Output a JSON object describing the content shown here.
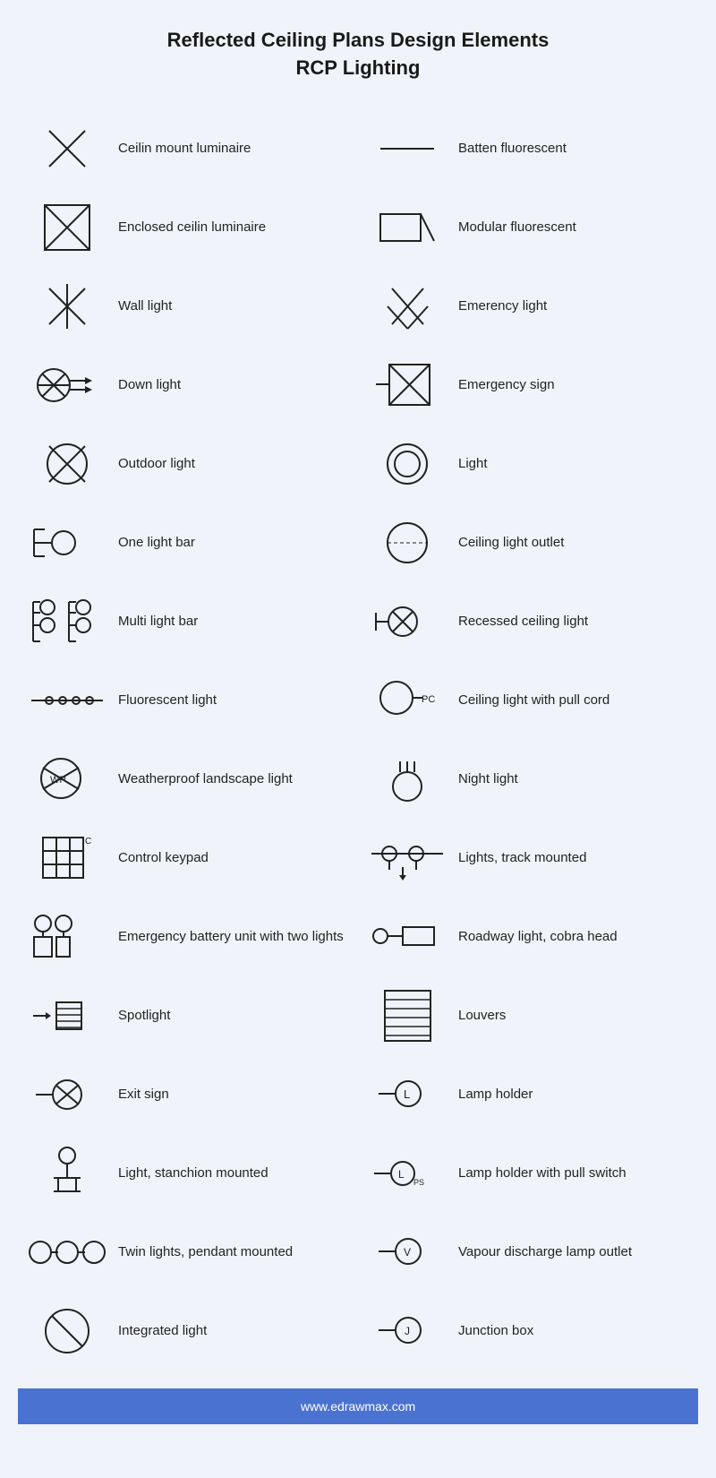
{
  "header": {
    "line1": "Reflected Ceiling Plans Design Elements",
    "line2": "RCP Lighting"
  },
  "items_left": [
    {
      "label": "Ceilin mount luminaire",
      "icon": "ceiling-mount"
    },
    {
      "label": "Enclosed ceilin luminaire",
      "icon": "enclosed-ceiling"
    },
    {
      "label": "Wall light",
      "icon": "wall-light"
    },
    {
      "label": "Down light",
      "icon": "down-light"
    },
    {
      "label": "Outdoor light",
      "icon": "outdoor-light"
    },
    {
      "label": "One light bar",
      "icon": "one-light-bar"
    },
    {
      "label": "Multi light bar",
      "icon": "multi-light-bar"
    },
    {
      "label": "Fluorescent light",
      "icon": "fluorescent-light"
    },
    {
      "label": "Weatherproof landscape light",
      "icon": "weatherproof"
    },
    {
      "label": "Control keypad",
      "icon": "control-keypad"
    },
    {
      "label": "Emergency battery unit with two lights",
      "icon": "emergency-battery"
    },
    {
      "label": "Spotlight",
      "icon": "spotlight"
    },
    {
      "label": "Exit sign",
      "icon": "exit-sign"
    },
    {
      "label": "Light, stanchion mounted",
      "icon": "stanchion"
    },
    {
      "label": "Twin lights, pendant mounted",
      "icon": "twin-pendant"
    },
    {
      "label": "Integrated light",
      "icon": "integrated-light"
    }
  ],
  "items_right": [
    {
      "label": "Batten fluorescent",
      "icon": "batten"
    },
    {
      "label": "Modular fluorescent",
      "icon": "modular-fluorescent"
    },
    {
      "label": "Emerency light",
      "icon": "emergency-light"
    },
    {
      "label": "Emergency sign",
      "icon": "emergency-sign"
    },
    {
      "label": "Light",
      "icon": "light-circle"
    },
    {
      "label": "Ceiling light outlet",
      "icon": "ceiling-outlet"
    },
    {
      "label": "Recessed ceiling light",
      "icon": "recessed-ceiling"
    },
    {
      "label": "Ceiling light with pull cord",
      "icon": "pull-cord"
    },
    {
      "label": "Night light",
      "icon": "night-light"
    },
    {
      "label": "Lights, track mounted",
      "icon": "track-mounted"
    },
    {
      "label": "Roadway light, cobra head",
      "icon": "cobra-head"
    },
    {
      "label": "Louvers",
      "icon": "louvers"
    },
    {
      "label": "Lamp holder",
      "icon": "lamp-holder"
    },
    {
      "label": "Lamp holder with pull switch",
      "icon": "lamp-pull-switch"
    },
    {
      "label": "Vapour discharge lamp outlet",
      "icon": "vapour-discharge"
    },
    {
      "label": "Junction box",
      "icon": "junction-box"
    }
  ],
  "footer": {
    "text": "www.edrawmax.com"
  }
}
